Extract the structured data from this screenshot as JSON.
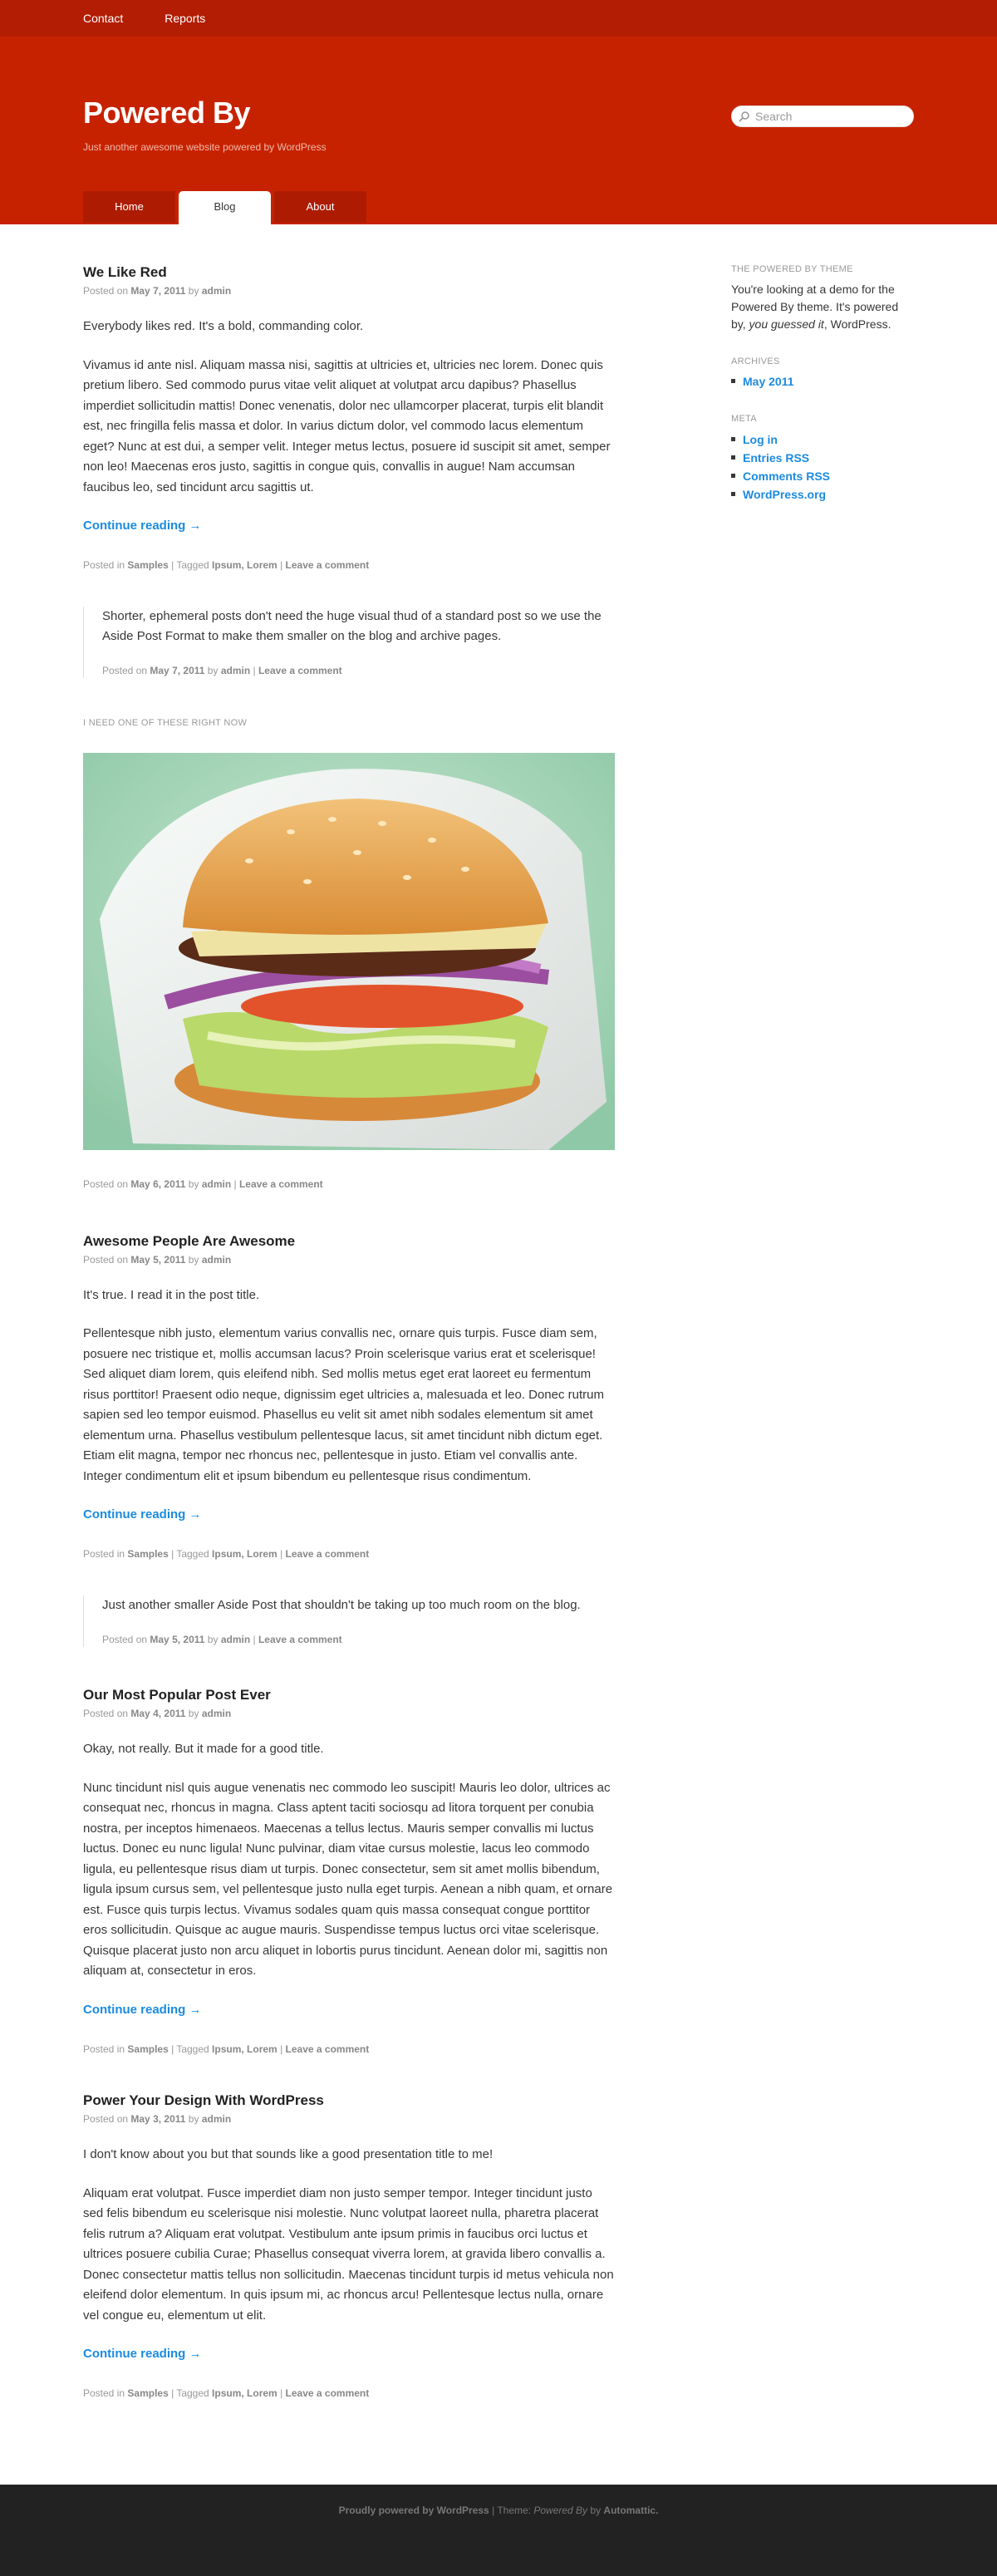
{
  "topnav": {
    "items": [
      "Contact",
      "Reports"
    ]
  },
  "header": {
    "title": "Powered By",
    "description": "Just another awesome website powered by WordPress",
    "search_placeholder": "Search",
    "nav": [
      "Home",
      "Blog",
      "About"
    ],
    "active_nav": "Blog",
    "bg_color": "#c72200"
  },
  "posts": [
    {
      "title": "We Like Red",
      "posted_on_label": "Posted on",
      "date": "May 7, 2011",
      "by_label": "by",
      "author": "admin",
      "paragraphs": [
        "Everybody likes red. It's a bold, commanding color.",
        "Vivamus id ante nisl. Aliquam massa nisi, sagittis at ultricies et, ultricies nec lorem. Donec quis pretium libero. Sed commodo purus vitae velit aliquet at volutpat arcu dapibus? Phasellus imperdiet sollicitudin mattis! Donec venenatis, dolor nec ullamcorper placerat, turpis elit blandit est, nec fringilla felis massa et dolor. In varius dictum dolor, vel commodo lacus elementum eget? Nunc at est dui, a semper velit. Integer metus lectus, posuere id suscipit sit amet, semper non leo! Maecenas eros justo, sagittis in congue quis, convallis in augue! Nam accumsan faucibus leo, sed tincidunt arcu sagittis ut."
      ],
      "continue": "Continue reading →",
      "posted_in_label": "Posted in",
      "category": "Samples",
      "tagged_label": "Tagged",
      "tags": "Ipsum, Lorem",
      "comment": "Leave a comment"
    },
    {
      "title": "Awesome People Are Awesome",
      "posted_on_label": "Posted on",
      "date": "May 5, 2011",
      "by_label": "by",
      "author": "admin",
      "paragraphs": [
        "It's true. I read it in the post title.",
        "Pellentesque nibh justo, elementum varius convallis nec, ornare quis turpis. Fusce diam sem, posuere nec tristique et, mollis accumsan lacus? Proin scelerisque varius erat et scelerisque! Sed aliquet diam lorem, quis eleifend nibh. Sed mollis metus eget erat laoreet eu fermentum risus porttitor! Praesent odio neque, dignissim eget ultricies a, malesuada et leo. Donec rutrum sapien sed leo tempor euismod. Phasellus eu velit sit amet nibh sodales elementum sit amet elementum urna. Phasellus vestibulum pellentesque lacus, sit amet tincidunt nibh dictum eget. Etiam elit magna, tempor nec rhoncus nec, pellentesque in justo. Etiam vel convallis ante. Integer condimentum elit et ipsum bibendum eu pellentesque risus condimentum."
      ],
      "continue": "Continue reading →",
      "posted_in_label": "Posted in",
      "category": "Samples",
      "tagged_label": "Tagged",
      "tags": "Ipsum, Lorem",
      "comment": "Leave a comment"
    },
    {
      "title": "Our Most Popular Post Ever",
      "posted_on_label": "Posted on",
      "date": "May 4, 2011",
      "by_label": "by",
      "author": "admin",
      "paragraphs": [
        "Okay, not really. But it made for a good title.",
        "Nunc tincidunt nisl quis augue venenatis nec commodo leo suscipit! Mauris leo dolor, ultrices ac consequat nec, rhoncus in magna. Class aptent taciti sociosqu ad litora torquent per conubia nostra, per inceptos himenaeos. Maecenas a tellus lectus. Mauris semper convallis mi luctus luctus. Donec eu nunc ligula! Nunc pulvinar, diam vitae cursus molestie, lacus leo commodo ligula, eu pellentesque risus diam ut turpis. Donec consectetur, sem sit amet mollis bibendum, ligula ipsum cursus sem, vel pellentesque justo nulla eget turpis. Aenean a nibh quam, et ornare est. Fusce quis turpis lectus. Vivamus sodales quam quis massa consequat congue porttitor eros sollicitudin. Quisque ac augue mauris. Suspendisse tempus luctus orci vitae scelerisque. Quisque placerat justo non arcu aliquet in lobortis purus tincidunt. Aenean dolor mi, sagittis non aliquam at, consectetur in eros."
      ],
      "continue": "Continue reading →",
      "posted_in_label": "Posted in",
      "category": "Samples",
      "tagged_label": "Tagged",
      "tags": "Ipsum, Lorem",
      "comment": "Leave a comment"
    },
    {
      "title": "Power Your Design With WordPress",
      "posted_on_label": "Posted on",
      "date": "May 3, 2011",
      "by_label": "by",
      "author": "admin",
      "paragraphs": [
        "I don't know about you but that sounds like a good presentation title to me!",
        "Aliquam erat volutpat. Fusce imperdiet diam non justo semper tempor. Integer tincidunt justo sed felis bibendum eu scelerisque nisi molestie. Nunc volutpat laoreet nulla, pharetra placerat felis rutrum a? Aliquam erat volutpat. Vestibulum ante ipsum primis in faucibus orci luctus et ultrices posuere cubilia Curae; Phasellus consequat viverra lorem, at gravida libero convallis a. Donec consectetur mattis tellus non sollicitudin. Maecenas tincidunt turpis id metus vehicula non eleifend dolor elementum. In quis ipsum mi, ac rhoncus arcu! Pellentesque lectus nulla, ornare vel congue eu, elementum ut elit."
      ],
      "continue": "Continue reading →",
      "posted_in_label": "Posted in",
      "category": "Samples",
      "tagged_label": "Tagged",
      "tags": "Ipsum, Lorem",
      "comment": "Leave a comment"
    }
  ],
  "asides": [
    {
      "text": "Shorter, ephemeral posts don't need the huge visual thud of a standard post so we use the Aside Post Format to make them smaller on the blog and archive pages.",
      "posted_on_label": "Posted on",
      "date": "May 7, 2011",
      "by_label": "by",
      "author": "admin",
      "comment": "Leave a comment"
    },
    {
      "text": "Just another smaller Aside Post that shouldn't be taking up too much room on the blog.",
      "posted_on_label": "Posted on",
      "date": "May 5, 2011",
      "by_label": "by",
      "author": "admin",
      "comment": "Leave a comment"
    }
  ],
  "image_post": {
    "label": "I NEED ONE OF THESE RIGHT NOW",
    "posted_on_label": "Posted on",
    "date": "May 6, 2011",
    "by_label": "by",
    "author": "admin",
    "comment": "Leave a comment"
  },
  "sidebar": {
    "about_title": "THE POWERED BY THEME",
    "about_text_1": "You're looking at a demo for the Powered By theme. It's powered by,",
    "about_text_em": "you guessed it",
    "about_text_2": ", WordPress.",
    "archives_title": "ARCHIVES",
    "archives": [
      "May 2011"
    ],
    "meta_title": "META",
    "meta": [
      "Log in",
      "Entries RSS",
      "Comments RSS",
      "WordPress.org"
    ]
  },
  "footer": {
    "powered": "Proudly powered by WordPress",
    "theme_label": "Theme:",
    "theme_name": "Powered By",
    "by_label": "by",
    "author": "Automattic."
  }
}
